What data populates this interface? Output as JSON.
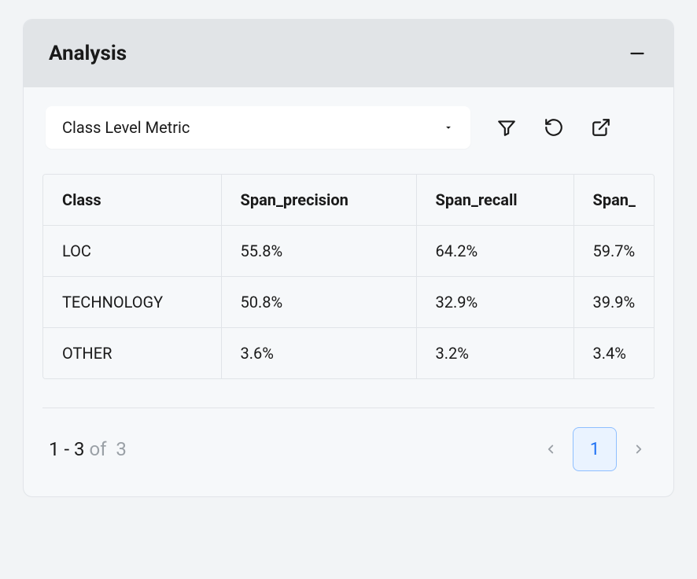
{
  "panel": {
    "title": "Analysis"
  },
  "toolbar": {
    "dropdown_label": "Class Level Metric"
  },
  "table": {
    "headers": {
      "col0": "Class",
      "col1": "Span_precision",
      "col2": "Span_recall",
      "col3": "Span_"
    },
    "rows": [
      {
        "class": "LOC",
        "span_precision": "55.8%",
        "span_recall": "64.2%",
        "span_f": "59.7%"
      },
      {
        "class": "TECHNOLOGY",
        "span_precision": "50.8%",
        "span_recall": "32.9%",
        "span_f": "39.9%"
      },
      {
        "class": "OTHER",
        "span_precision": "3.6%",
        "span_recall": "3.2%",
        "span_f": "3.4%"
      }
    ]
  },
  "pagination": {
    "range": "1 - 3",
    "of_label": "of",
    "total": "3",
    "current_page": "1"
  }
}
